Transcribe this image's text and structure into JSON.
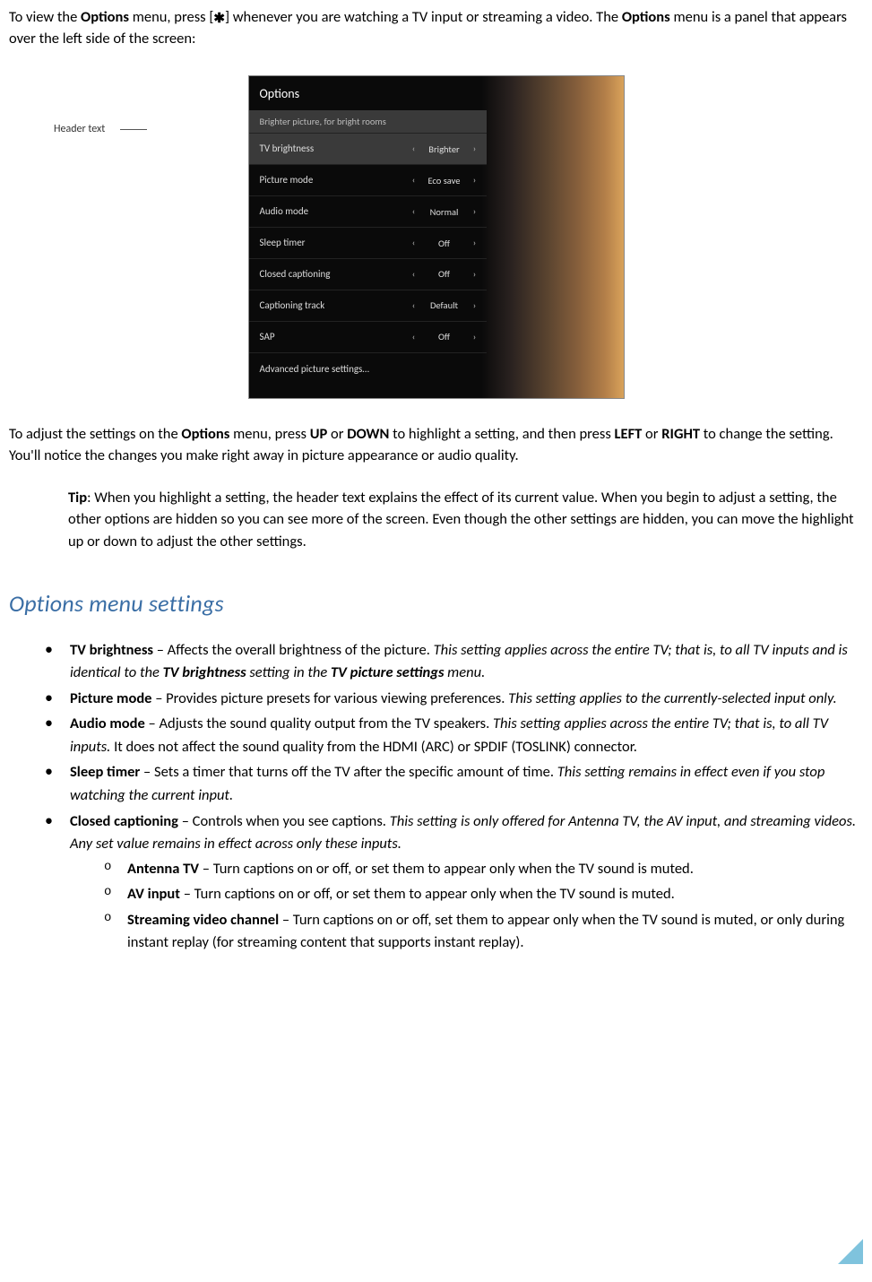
{
  "intro": {
    "pre1": "To view the ",
    "b1": "Options",
    "mid1": " menu, press [",
    "starchar": "✱",
    "mid2": "] whenever you are watching a TV input or streaming a video. The ",
    "b2": "Options",
    "post": " menu is a panel that appears over the left side of the screen:"
  },
  "screenshot": {
    "header_label": "Header text",
    "options_title": "Options",
    "header_text": "Brighter picture, for bright rooms",
    "rows": [
      {
        "label": "TV brightness",
        "value": "Brighter"
      },
      {
        "label": "Picture mode",
        "value": "Eco save"
      },
      {
        "label": "Audio mode",
        "value": "Normal"
      },
      {
        "label": "Sleep timer",
        "value": "Off"
      },
      {
        "label": "Closed captioning",
        "value": "Off"
      },
      {
        "label": "Captioning track",
        "value": "Default"
      },
      {
        "label": "SAP",
        "value": "Off"
      }
    ],
    "advanced": "Advanced picture settings…",
    "chev_left": "‹",
    "chev_right": "›"
  },
  "para2": {
    "p1": "To adjust the settings on the ",
    "b1": "Options",
    "p2": " menu, press ",
    "b2": "UP",
    "p3": " or ",
    "b3": "DOWN",
    "p4": " to highlight a setting, and then press ",
    "b4": "LEFT",
    "p5": " or ",
    "b5": "RIGHT",
    "p6": " to change the setting. You'll notice the changes you make right away in picture appearance or audio quality."
  },
  "tip": {
    "label": "Tip",
    "text": ": When you highlight a setting, the header text explains the effect of its current value. When you begin to adjust a setting, the other options are hidden so you can see more of the screen. Even though the other settings are hidden, you can move the highlight up or down to adjust the other settings."
  },
  "heading": "Options menu settings",
  "items": {
    "tv_brightness": {
      "name": "TV brightness",
      "desc": " – Affects the overall brightness of the picture. ",
      "ital_pre": "This setting applies across the entire TV; that is, to all TV inputs and is identical to the ",
      "ital_b1": "TV brightness",
      "ital_mid": " setting in the ",
      "ital_b2": "TV picture settings",
      "ital_post": " menu."
    },
    "picture_mode": {
      "name": "Picture mode",
      "desc": " – Provides picture presets for various viewing preferences. ",
      "ital": "This setting applies to the currently-selected input only."
    },
    "audio_mode": {
      "name": "Audio mode",
      "desc": " – Adjusts the sound quality output from the TV speakers. ",
      "ital": "This setting applies across the entire TV; that is, to all TV inputs.",
      "tail": " It does not affect the sound quality from the HDMI (ARC) or SPDIF (TOSLINK) connector."
    },
    "sleep_timer": {
      "name": "Sleep timer",
      "desc": " – Sets a timer that turns off the TV after the specific amount of time. ",
      "ital": "This setting remains in effect even if you stop watching the current input."
    },
    "closed_captioning": {
      "name": "Closed captioning",
      "desc": " – Controls when you see captions. ",
      "ital": "This setting is only offered for Antenna TV, the AV input, and streaming videos. Any set value remains in effect across only these inputs.",
      "sub": {
        "antenna": {
          "name": "Antenna TV",
          "desc": " – Turn captions on or off, or set them to appear only when the TV sound is muted."
        },
        "av": {
          "name": "AV input",
          "desc": " – Turn captions on or off, or set them to appear only when the TV sound is muted."
        },
        "stream": {
          "name": "Streaming video channel",
          "desc": " – Turn captions on or off, set them to appear only when the TV sound is muted, or only during instant replay (for streaming content that supports instant replay)."
        }
      }
    }
  }
}
